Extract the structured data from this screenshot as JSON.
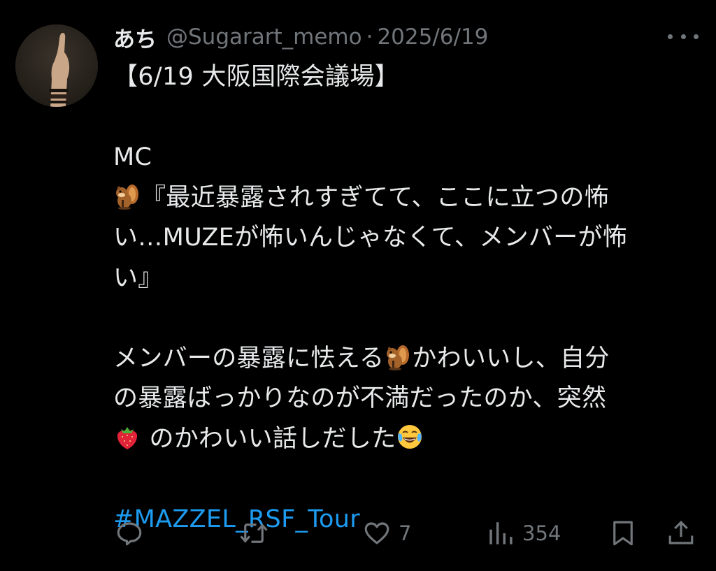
{
  "tweet": {
    "author_name": "あち",
    "handle": "@Sugarart_memo",
    "separator": "·",
    "date": "2025/6/19",
    "lines": {
      "l1": "【6/19 大阪国際会議場】",
      "l2": "MC",
      "l3": "『最近暴露されすぎてて、ここに立つの怖",
      "l4": "い…MUZEが怖いんじゃなくて、メンバーが怖",
      "l5": "い』",
      "l6a": "メンバーの暴露に怯える",
      "l6b": "かわいいし、自分",
      "l7": "の暴露ばっかりなのが不満だったのか、突然",
      "l8": "のかわいい話しだした"
    },
    "hashtag": "#MAZZEL_RSF_Tour",
    "icons": {
      "avatar": "raised-hand-avatar",
      "more": "more-dots-icon",
      "chipmunk": "chipmunk-emoji",
      "strawberry": "strawberry-emoji",
      "laughing": "tears-of-joy-emoji",
      "reply": "reply-icon",
      "retweet": "retweet-icon",
      "like": "heart-icon",
      "views": "views-icon",
      "bookmark": "bookmark-icon",
      "share": "share-icon"
    }
  },
  "actions": {
    "likes": "7",
    "views": "354"
  },
  "colors": {
    "background": "#000000",
    "text": "#e7e9ea",
    "muted": "#71767b",
    "link": "#1d9bf0"
  }
}
